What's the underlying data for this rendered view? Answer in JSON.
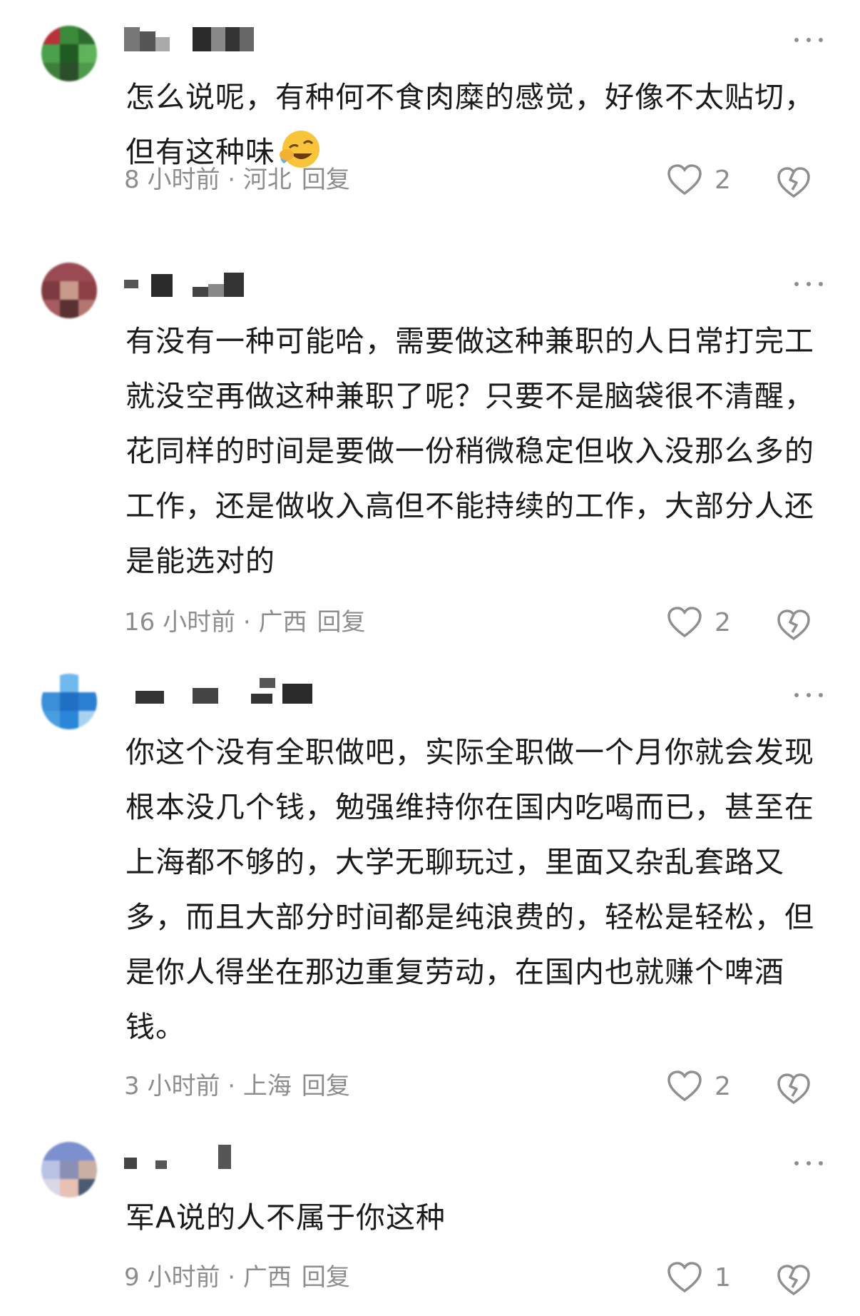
{
  "comments": [
    {
      "text": "怎么说呢，有种何不食肉糜的感觉，好像不太贴切，但有这种味",
      "emoji": "laugh-cry-emoji",
      "time": "8 小时前",
      "location": "河北",
      "reply": "回复",
      "likes": "2"
    },
    {
      "text": "有没有一种可能哈，需要做这种兼职的人日常打完工就没空再做这种兼职了呢？只要不是脑袋很不清醒，花同样的时间是要做一份稍微稳定但收入没那么多的工作，还是做收入高但不能持续的工作，大部分人还是能选对的",
      "time": "16 小时前",
      "location": "广西",
      "reply": "回复",
      "likes": "2"
    },
    {
      "text": "你这个没有全职做吧，实际全职做一个月你就会发现根本没几个钱，勉强维持你在国内吃喝而已，甚至在上海都不够的，大学无聊玩过，里面又杂乱套路又多，而且大部分时间都是纯浪费的，轻松是轻松，但是你人得坐在那边重复劳动，在国内也就赚个啤酒钱。",
      "time": "3 小时前",
      "location": "上海",
      "reply": "回复",
      "likes": "2"
    },
    {
      "text": "军A说的人不属于你这种",
      "time": "9 小时前",
      "location": "广西",
      "reply": "回复",
      "likes": "1"
    }
  ],
  "separator": " · ",
  "colors": {
    "text": "#1b1b1b",
    "meta": "#8d8d8d",
    "icon": "#8f8f8f"
  }
}
